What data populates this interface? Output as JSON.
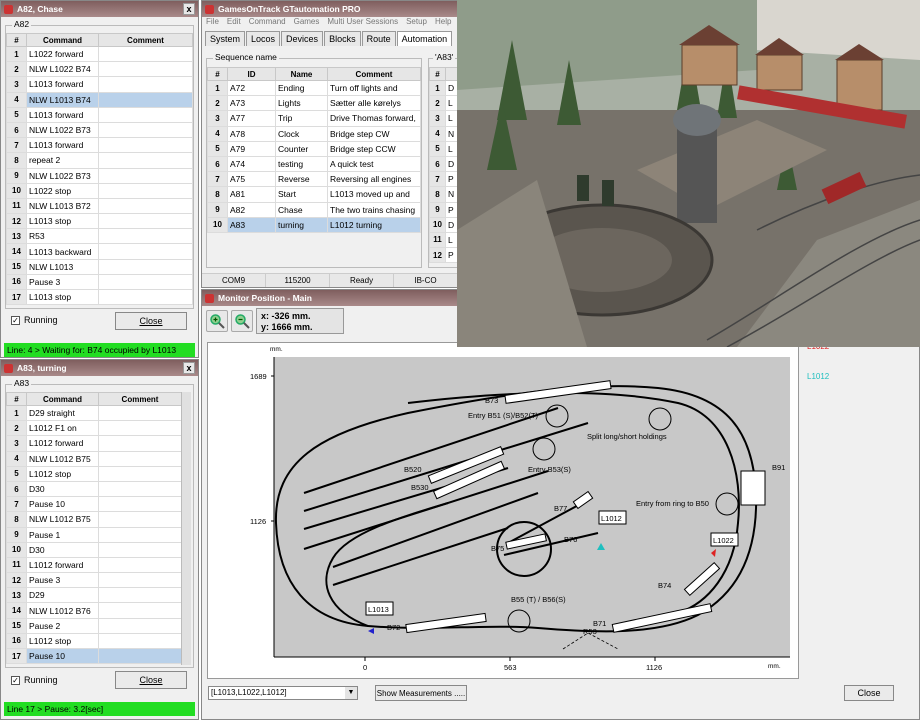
{
  "w82": {
    "title": "A82, Chase",
    "group": "A82",
    "cols": [
      "#",
      "Command",
      "Comment"
    ],
    "rows": [
      {
        "n": "1",
        "cmd": "L1022 forward",
        "comment": ""
      },
      {
        "n": "2",
        "cmd": "NLW L1022 B74",
        "comment": ""
      },
      {
        "n": "3",
        "cmd": "L1013 forward",
        "comment": ""
      },
      {
        "n": "4",
        "cmd": "NLW L1013 B74",
        "comment": ""
      },
      {
        "n": "5",
        "cmd": "L1013 forward",
        "comment": ""
      },
      {
        "n": "6",
        "cmd": "NLW L1022 B73",
        "comment": ""
      },
      {
        "n": "7",
        "cmd": "L1013 forward",
        "comment": ""
      },
      {
        "n": "8",
        "cmd": "repeat 2",
        "comment": ""
      },
      {
        "n": "9",
        "cmd": "NLW L1022 B73",
        "comment": ""
      },
      {
        "n": "10",
        "cmd": "L1022 stop",
        "comment": ""
      },
      {
        "n": "11",
        "cmd": "NLW L1013 B72",
        "comment": ""
      },
      {
        "n": "12",
        "cmd": "L1013 stop",
        "comment": ""
      },
      {
        "n": "13",
        "cmd": "R53",
        "comment": ""
      },
      {
        "n": "14",
        "cmd": "L1013 backward",
        "comment": ""
      },
      {
        "n": "15",
        "cmd": "NLW L1013",
        "comment": ""
      },
      {
        "n": "16",
        "cmd": "Pause 3",
        "comment": ""
      },
      {
        "n": "17",
        "cmd": "L1013 stop",
        "comment": ""
      }
    ],
    "selected_row": "4",
    "running_label": "Running",
    "close_label": "Close",
    "status": "Line: 4 > Waiting for: B74 occupied by L1013"
  },
  "w83": {
    "title": "A83, turning",
    "group": "A83",
    "cols": [
      "#",
      "Command",
      "Comment"
    ],
    "rows": [
      {
        "n": "1",
        "cmd": "D29 straight",
        "comment": ""
      },
      {
        "n": "2",
        "cmd": "L1012 F1 on",
        "comment": ""
      },
      {
        "n": "3",
        "cmd": "L1012 forward",
        "comment": ""
      },
      {
        "n": "4",
        "cmd": "NLW L1012 B75",
        "comment": ""
      },
      {
        "n": "5",
        "cmd": "L1012 stop",
        "comment": ""
      },
      {
        "n": "6",
        "cmd": "D30",
        "comment": ""
      },
      {
        "n": "7",
        "cmd": "Pause 10",
        "comment": ""
      },
      {
        "n": "8",
        "cmd": "NLW L1012 B75",
        "comment": ""
      },
      {
        "n": "9",
        "cmd": "Pause 1",
        "comment": ""
      },
      {
        "n": "10",
        "cmd": "D30",
        "comment": ""
      },
      {
        "n": "11",
        "cmd": "L1012 forward",
        "comment": ""
      },
      {
        "n": "12",
        "cmd": "Pause 3",
        "comment": ""
      },
      {
        "n": "13",
        "cmd": "D29",
        "comment": ""
      },
      {
        "n": "14",
        "cmd": "NLW L1012 B76",
        "comment": ""
      },
      {
        "n": "15",
        "cmd": "Pause 2",
        "comment": ""
      },
      {
        "n": "16",
        "cmd": "L1012 stop",
        "comment": ""
      },
      {
        "n": "17",
        "cmd": "Pause 10",
        "comment": ""
      }
    ],
    "selected_row": "17",
    "running_label": "Running",
    "close_label": "Close",
    "status": "Line 17 > Pause: 3.2[sec]"
  },
  "main": {
    "title": "GamesOnTrack  GTautomation PRO",
    "menu": [
      "File",
      "Edit",
      "Command",
      "Games",
      "Multi User Sessions",
      "Setup",
      "Help"
    ],
    "tabs": [
      "System",
      "Locos",
      "Devices",
      "Blocks",
      "Route",
      "Automation"
    ],
    "active_tab": "Automation",
    "seq_group": "Sequence name",
    "right_group": "'A83'",
    "seq_cols": [
      "#",
      "ID",
      "Name",
      "Comment"
    ],
    "seq_rows": [
      {
        "n": "1",
        "id": "A72",
        "name": "Ending",
        "comment": "Turn off lights and"
      },
      {
        "n": "2",
        "id": "A73",
        "name": "Lights",
        "comment": "Sætter alle kørelys"
      },
      {
        "n": "3",
        "id": "A77",
        "name": "Trip",
        "comment": "Drive Thomas forward,"
      },
      {
        "n": "4",
        "id": "A78",
        "name": "Clock",
        "comment": "Bridge step CW"
      },
      {
        "n": "5",
        "id": "A79",
        "name": "Counter",
        "comment": "Bridge step CCW"
      },
      {
        "n": "6",
        "id": "A74",
        "name": "testing",
        "comment": "A quick test"
      },
      {
        "n": "7",
        "id": "A75",
        "name": "Reverse",
        "comment": "Reversing all engines"
      },
      {
        "n": "8",
        "id": "A81",
        "name": "Start",
        "comment": "L1013 moved up and"
      },
      {
        "n": "9",
        "id": "A82",
        "name": "Chase",
        "comment": "The two trains chasing"
      },
      {
        "n": "10",
        "id": "A83",
        "name": "turning",
        "comment": "L1012 turning"
      }
    ],
    "selected_seq": "10",
    "right_cols": [
      "#"
    ],
    "right_rows": [
      {
        "n": "1",
        "v": "D"
      },
      {
        "n": "2",
        "v": "L"
      },
      {
        "n": "3",
        "v": "L"
      },
      {
        "n": "4",
        "v": "N"
      },
      {
        "n": "5",
        "v": "L"
      },
      {
        "n": "6",
        "v": "D"
      },
      {
        "n": "7",
        "v": "P"
      },
      {
        "n": "8",
        "v": "N"
      },
      {
        "n": "9",
        "v": "P"
      },
      {
        "n": "10",
        "v": "D"
      },
      {
        "n": "11",
        "v": "L"
      },
      {
        "n": "12",
        "v": "P"
      }
    ],
    "statusbar": [
      "COM9",
      "115200",
      "Ready",
      "IB-CO"
    ]
  },
  "monitor": {
    "title": "Monitor Position - Main",
    "coord_x": "x: -326 mm.",
    "coord_y": "y: 1666 mm.",
    "loco_select": "[L1013,L1022,L1012]",
    "show_measurements": "Show Measurements .....",
    "close_label": "Close",
    "legend_partial": "L1022",
    "legend": "L1012",
    "axis_unit_y": "mm.",
    "axis_unit_x": "mm.",
    "y_ticks": [
      "1689",
      "1126"
    ],
    "x_ticks": [
      "0",
      "563",
      "1126"
    ],
    "labels": {
      "b73": "B73",
      "entry_b51": "Entry B51 (S)/B52(T)",
      "split": "Split long/short holdings",
      "b91": "B91",
      "b520": "B520",
      "entry_b53": "Entry B53(S)",
      "b530": "B530",
      "entry_ring": "Entry from ring to B50",
      "b77": "B77",
      "b76": "B76",
      "b75": "B75",
      "b74": "B74",
      "b55": "B55 (T) / B56(S)",
      "b72": "B72",
      "b71": "B71",
      "sw": "R53",
      "loco_a": "L1012",
      "loco_b": "L1022",
      "loco_c": "L1013"
    }
  },
  "colors": {
    "status_green": "#22dd22",
    "selection": "#b9d1ea",
    "title_bar": "#8f6f6f",
    "legend_cyan": "#1fbfbf"
  }
}
